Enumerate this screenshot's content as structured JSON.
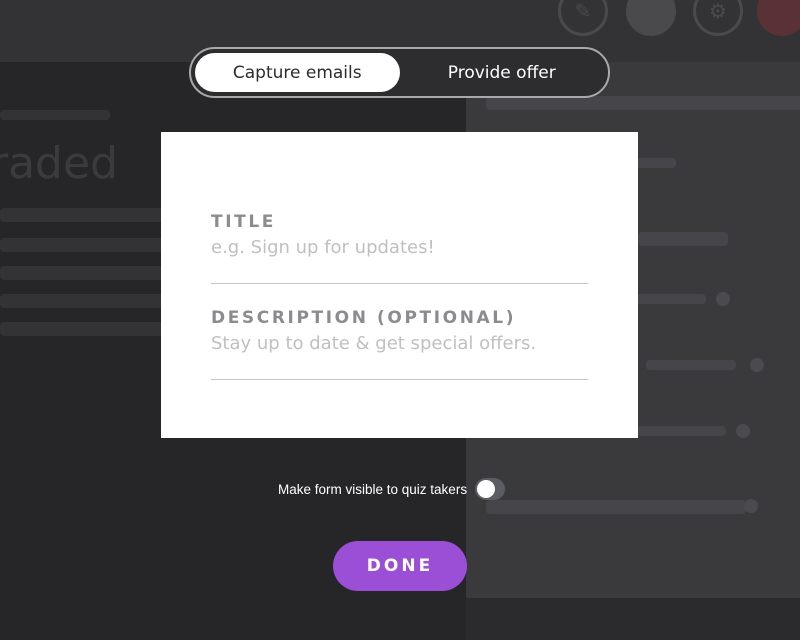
{
  "tabs": [
    {
      "label": "Capture emails",
      "active": true
    },
    {
      "label": "Provide offer",
      "active": false
    }
  ],
  "form": {
    "title_label": "TITLE",
    "title_placeholder": "e.g. Sign up for updates!",
    "description_label": "DESCRIPTION (OPTIONAL)",
    "description_placeholder": "Stay up to date & get special offers."
  },
  "visibility_toggle": {
    "label": "Make form visible to quiz takers",
    "on": false
  },
  "done_button": {
    "label": "DONE"
  },
  "colors": {
    "accent": "#9b4fd6",
    "backdrop": "#2b2b2d",
    "card": "#ffffff",
    "label_gray": "#8c8c90",
    "placeholder_gray": "#c0c0c3"
  },
  "icons": [
    "pencil-icon",
    "download-icon",
    "settings-icon",
    "info-icon"
  ]
}
